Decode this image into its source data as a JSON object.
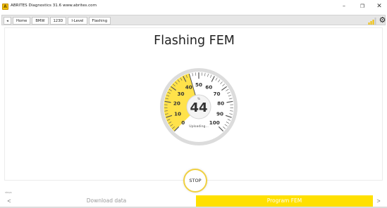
{
  "window": {
    "title": "ABRITES Diagnostics 31.6   www.abrites.com",
    "app_icon_glyph": "A",
    "minimize_glyph": "–",
    "maximize_glyph": "❐",
    "close_glyph": "✕"
  },
  "toolbar": {
    "back_glyph": "◂",
    "breadcrumbs": [
      "Home",
      "BMW",
      "123D",
      "I-Level",
      "Flashing"
    ],
    "signal_icon": "signal-strength-icon",
    "settings_icon": "gear-icon",
    "settings_glyph": "⚙",
    "colors": {
      "signal": "#f0c000",
      "signal_muted": "#c9c9c9"
    }
  },
  "main": {
    "title": "Flashing FEM",
    "gauge": {
      "value": 44,
      "min": 0,
      "max": 100,
      "value_text": "44",
      "unit": "%",
      "status": "Uploading...",
      "tick_labels": [
        "0",
        "10",
        "20",
        "30",
        "40",
        "50",
        "60",
        "70",
        "80",
        "90",
        "100"
      ],
      "colors": {
        "fill": "#ffe24a",
        "face": "#ffffff",
        "ring": "#d8d8d8",
        "text": "#333333"
      }
    },
    "stop_label": "STOP"
  },
  "footer": {
    "steps_label": "steps",
    "prev_glyph": "<",
    "next_glyph": ">",
    "steps": [
      {
        "label": "Download data",
        "state": "done"
      },
      {
        "label": "Program FEM",
        "state": "active"
      }
    ],
    "colors": {
      "active": "#ffe000",
      "done_text": "#9a9a9a"
    }
  }
}
